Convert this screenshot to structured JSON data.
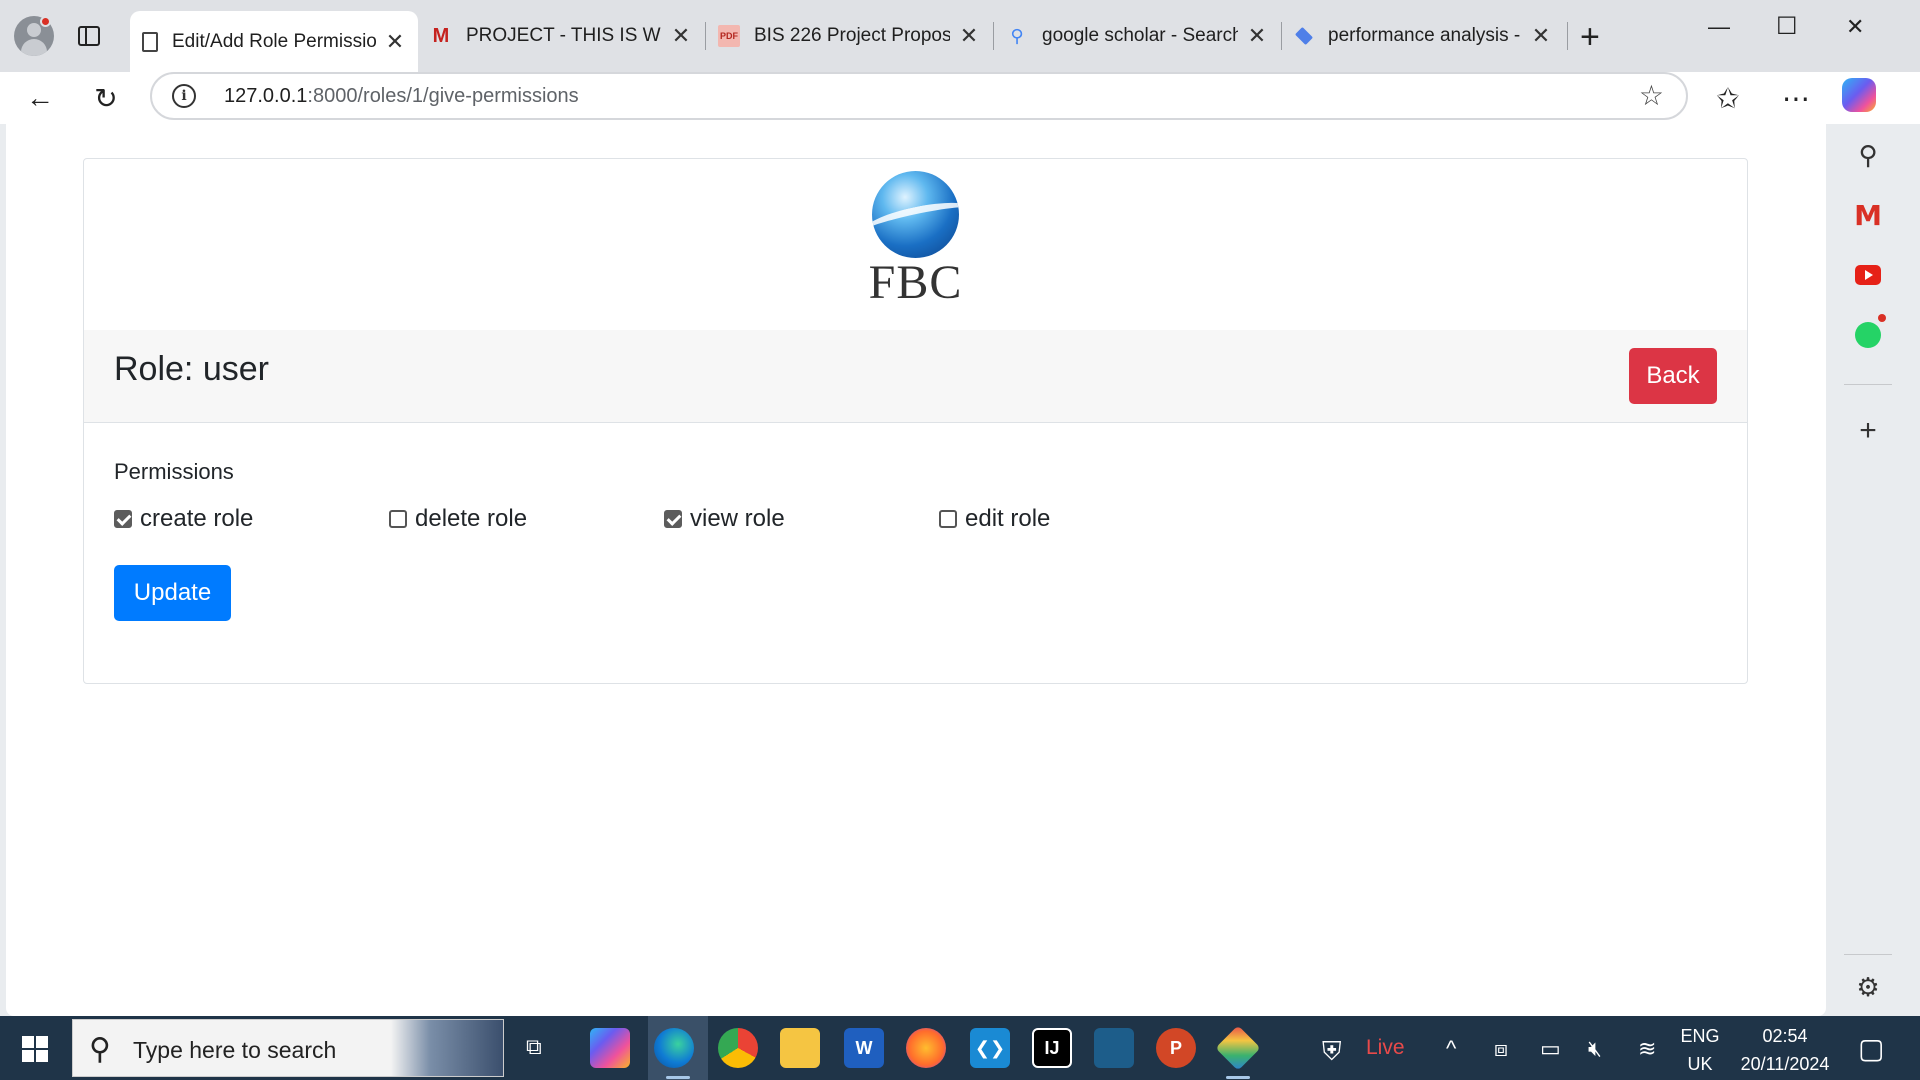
{
  "browser": {
    "tabs": [
      {
        "title": "Edit/Add Role Permission",
        "icon": "document-icon",
        "active": true
      },
      {
        "title": "PROJECT - THIS IS WHAT",
        "icon": "gmail-icon"
      },
      {
        "title": "BIS 226 Project Proposal",
        "icon": "pdf-icon"
      },
      {
        "title": "google scholar - Search",
        "icon": "search-icon"
      },
      {
        "title": "performance analysis - G",
        "icon": "gemini-icon"
      }
    ],
    "url_host": "127.0.0.1",
    "url_path": ":8000/roles/1/give-permissions"
  },
  "page": {
    "logo_text": "FBC",
    "role_title": "Role: user",
    "back_label": "Back",
    "permissions_label": "Permissions",
    "permissions": [
      {
        "label": "create role",
        "checked": true
      },
      {
        "label": "delete role",
        "checked": false
      },
      {
        "label": "view role",
        "checked": true
      },
      {
        "label": "edit role",
        "checked": false
      }
    ],
    "update_label": "Update"
  },
  "taskbar": {
    "search_placeholder": "Type here to search",
    "live_label": "Live",
    "language": "ENG",
    "region": "UK",
    "time": "02:54",
    "date": "20/11/2024"
  },
  "colors": {
    "back_button": "#dc3545",
    "update_button": "#007bff",
    "taskbar": "#1f3448"
  }
}
